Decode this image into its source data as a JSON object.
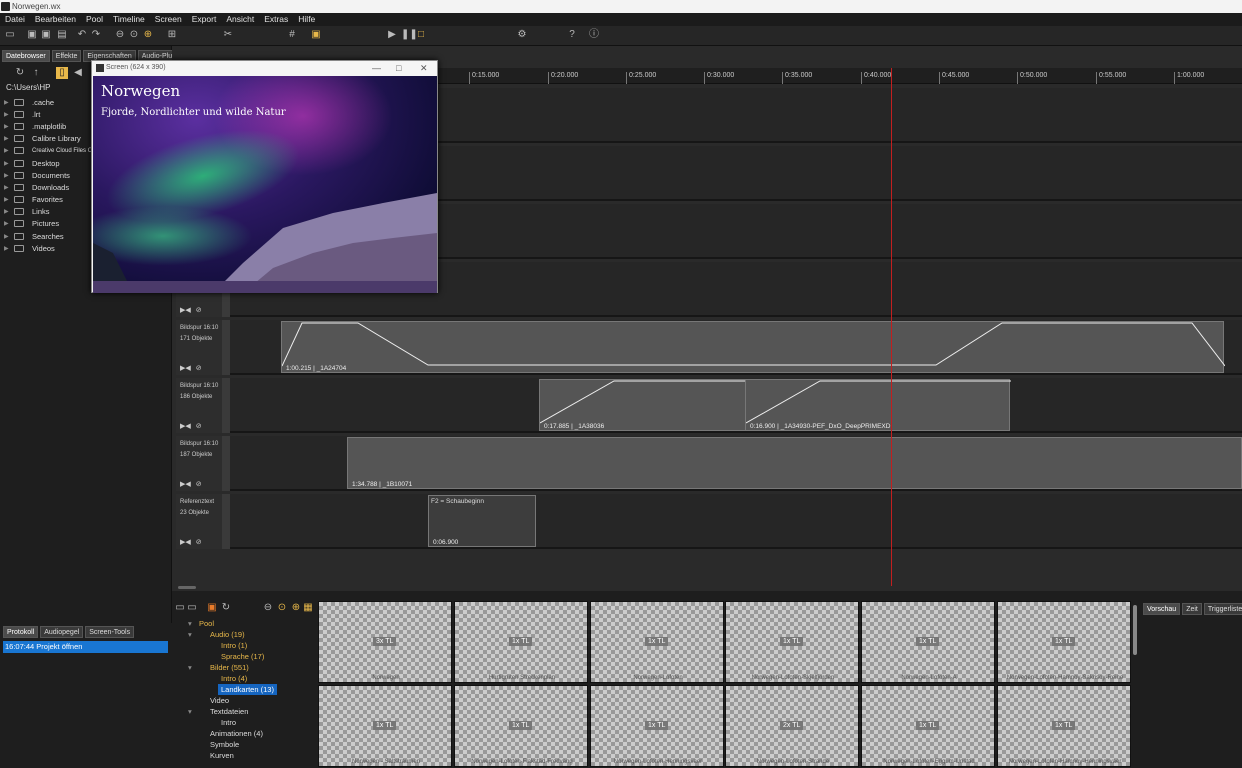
{
  "window": {
    "title": "Norwegen.wx"
  },
  "menu": [
    "Datei",
    "Bearbeiten",
    "Pool",
    "Timeline",
    "Screen",
    "Export",
    "Ansicht",
    "Extras",
    "Hilfe"
  ],
  "left_tabs": [
    "Datebrowser",
    "Effekte",
    "Eigenschaften",
    "Audio-Plugins"
  ],
  "path": "C:\\Users\\HP",
  "files": [
    ".cache",
    ".lrt",
    ".matplotlib",
    "Calibre Library",
    "Creative Cloud Files Comp",
    "Desktop",
    "Documents",
    "Downloads",
    "Favorites",
    "Links",
    "Pictures",
    "Searches",
    "Videos"
  ],
  "preview": {
    "window_title": "Screen (624 x 390)",
    "title": "Norwegen",
    "subtitle": "Fjorde, Nordlichter und wilde Natur"
  },
  "ruler_ticks": [
    "0:15.000",
    "0:20.000",
    "0:25.000",
    "0:30.000",
    "0:35.000",
    "0:40.000",
    "0:45.000",
    "0:50.000",
    "0:55.000",
    "1:00.000"
  ],
  "tracks": [
    {
      "label1": "Bildspur 16:10",
      "label2": "171 Objekte",
      "clips": [
        {
          "label": "1:00.215 | _1A24704"
        }
      ]
    },
    {
      "label1": "Bildspur 16:10",
      "label2": "186 Objekte",
      "clips": [
        {
          "label": "0:17.885 | _1A38036"
        },
        {
          "label": "0:16.900 | _1A34930-PEF_DxO_DeepPRIMEXD"
        }
      ]
    },
    {
      "label1": "Bildspur 16:10",
      "label2": "187 Objekte",
      "clips": [
        {
          "label": "1:34.788 | _1B10071"
        }
      ]
    },
    {
      "label1": "Referenztext",
      "label2": "23 Objekte",
      "clips": [
        {
          "title": "F2 = Schaubeginn",
          "label": "0:06.900"
        }
      ]
    }
  ],
  "bottom_left_tabs": [
    "Protokoll",
    "Audiopegel",
    "Screen-Tools"
  ],
  "log": {
    "time": "16:07:44",
    "text": "Projekt öffnen"
  },
  "pool": {
    "root": "Pool",
    "audio": "Audio (19)",
    "audio_intro": "Intro (1)",
    "audio_sprache": "Sprache (17)",
    "bilder": "Bilder (551)",
    "bilder_intro": "Intro (4)",
    "bilder_landkarten": "Landkarten (13)",
    "video": "Video",
    "textdateien": "Textdateien",
    "text_intro": "Intro",
    "animationen": "Animationen (4)",
    "symbole": "Symbole",
    "kurven": "Kurven"
  },
  "thumbnails": [
    {
      "badge": "3x TL",
      "name": "Norwegen"
    },
    {
      "badge": "1x TL",
      "name": "Hurtigruten Streckenplan"
    },
    {
      "badge": "1x TL",
      "name": "Norwegen-Lofoten"
    },
    {
      "badge": "1x TL",
      "name": "Norwegen-Lofoten-Skjelfjorden"
    },
    {
      "badge": "1x TL",
      "name": "Norwegen-Lofoten-A"
    },
    {
      "badge": "1x TL",
      "name": "Norwegen-Lofoten-Hamnoy-Sakrisoy-Reine"
    },
    {
      "badge": "1x TL",
      "name": "Norwegen - Saltstraumen"
    },
    {
      "badge": "1x TL",
      "name": "Norwegen-Lofoten-Flakstad-Fredvang"
    },
    {
      "badge": "1x TL",
      "name": "Norwegen-Lofoten-Henningsvaer"
    },
    {
      "badge": "2x TL",
      "name": "Norwegen-Lofoten-Strande"
    },
    {
      "badge": "1x TL",
      "name": "Norwegen-Lofoten-Eggum-Unstad"
    },
    {
      "badge": "1x TL",
      "name": "Norwegen-Lofoten-Hamnoy-Henningsvaer"
    }
  ],
  "right_tabs": [
    "Vorschau",
    "Zeit",
    "Triggerliste"
  ]
}
